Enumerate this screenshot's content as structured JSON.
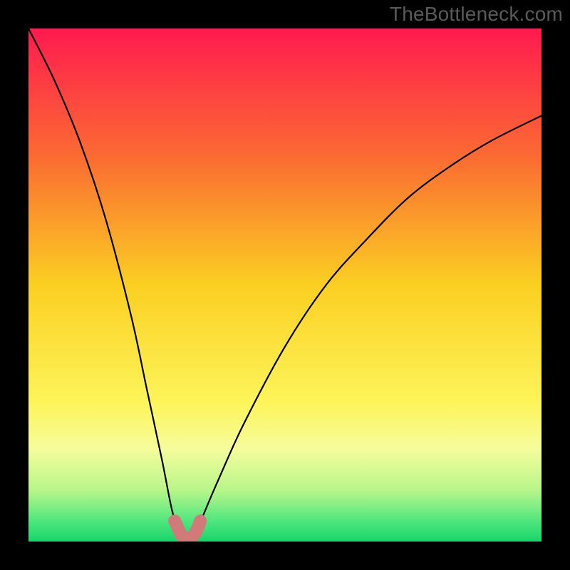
{
  "watermark": "TheBottleneck.com",
  "chart_data": {
    "type": "line",
    "title": "",
    "xlabel": "",
    "ylabel": "",
    "xlim": [
      0,
      100
    ],
    "ylim": [
      0,
      100
    ],
    "background_gradient": {
      "stops": [
        {
          "pct": 0,
          "color": "#ff1a4f"
        },
        {
          "pct": 25,
          "color": "#fb6b32"
        },
        {
          "pct": 50,
          "color": "#fbcf22"
        },
        {
          "pct": 73,
          "color": "#fdf55a"
        },
        {
          "pct": 82,
          "color": "#f6fc9c"
        },
        {
          "pct": 90,
          "color": "#b8f68a"
        },
        {
          "pct": 96,
          "color": "#4fe77e"
        },
        {
          "pct": 100,
          "color": "#17d56a"
        }
      ]
    },
    "series": [
      {
        "name": "bottleneck-curve",
        "color": "#000000",
        "x": [
          0,
          5,
          10,
          15,
          20,
          23,
          26,
          28,
          29.5,
          30.5,
          31.5,
          32.5,
          34,
          37,
          42,
          50,
          58,
          66,
          74,
          82,
          90,
          100
        ],
        "y": [
          100,
          90,
          78,
          63,
          44,
          30,
          16,
          6,
          1.5,
          0.3,
          0.3,
          1.5,
          5,
          12,
          23,
          38,
          50,
          59,
          67,
          73,
          78,
          83
        ]
      }
    ],
    "flat_segment": {
      "name": "minimum-band",
      "color": "#d17a7a",
      "x": [
        28.5,
        29.8,
        30.5,
        31.2,
        32.5,
        33.5
      ],
      "y": [
        4.0,
        1.2,
        0.6,
        0.6,
        1.6,
        4.0
      ]
    }
  }
}
